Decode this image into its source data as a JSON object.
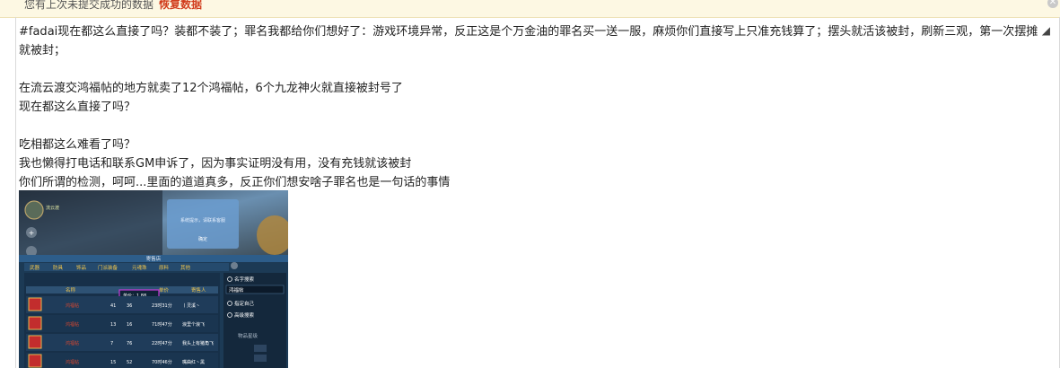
{
  "notice": {
    "message": "您有上次未提交成功的数据",
    "restore_label": "恢复数据",
    "close_icon": "close-icon"
  },
  "post": {
    "lines": [
      "#fadai现在都这么直接了吗？装都不装了；罪名我都给你们想好了：游戏环境异常，反正这是个万金油的罪名买一送一服，麻烦你们直接写上只准充钱算了；摆头就活该被封，刷新三观，第一次摆摊就被封；",
      "",
      "在流云渡交鸿福帖的地方就卖了12个鸿福帖，6个九龙神火就直接被封号了",
      "现在都这么直接了吗？",
      "",
      "吃相都这么难看了吗？",
      "我也懒得打电话和联系GM申诉了，因为事实证明没有用，没有充钱就该被封",
      "你们所谓的检测，呵呵...里面的道道真多，反正你们想安啥子罪名也是一句话的事情"
    ]
  },
  "screenshot": {
    "shop_title": "寄售店",
    "tabs": [
      "武器",
      "防具",
      "饰品",
      "门派装备",
      "元魂珠",
      "原料",
      "其他"
    ],
    "columns": [
      "名称",
      "单价",
      "寄售人"
    ],
    "price_tooltip": "单价：1  88",
    "search": {
      "name_search": "名字搜索",
      "query": "鸿福帖",
      "options": [
        "指定自己",
        "高级搜索"
      ],
      "grade_label": "物品星级"
    },
    "rows": [
      {
        "name": "鸿福帖",
        "qty": "41",
        "price": "36",
        "time": "23时31分",
        "seller": "丨灵溪丶"
      },
      {
        "name": "鸿福帖",
        "qty": "13",
        "price": "16",
        "time": "71时47分",
        "seller": "浪里个浪飞"
      },
      {
        "name": "鸿福帖",
        "qty": "7",
        "price": "76",
        "time": "22时47分",
        "seller": "我头上有猪角飞"
      },
      {
        "name": "鸿福帖",
        "qty": "15",
        "price": "52",
        "time": "70时46分",
        "seller": "嘴曲红丶黑"
      }
    ],
    "dialog_text": "系统提示，请联系客服",
    "dialog_button": "确定",
    "player_name": "流云渡",
    "colors": {
      "panel": "#1c3a55",
      "header": "#2d5d8a",
      "tab_text": "#f2c64c",
      "name_text": "#d9472f",
      "tooltip_border": "#c63ad8"
    }
  }
}
